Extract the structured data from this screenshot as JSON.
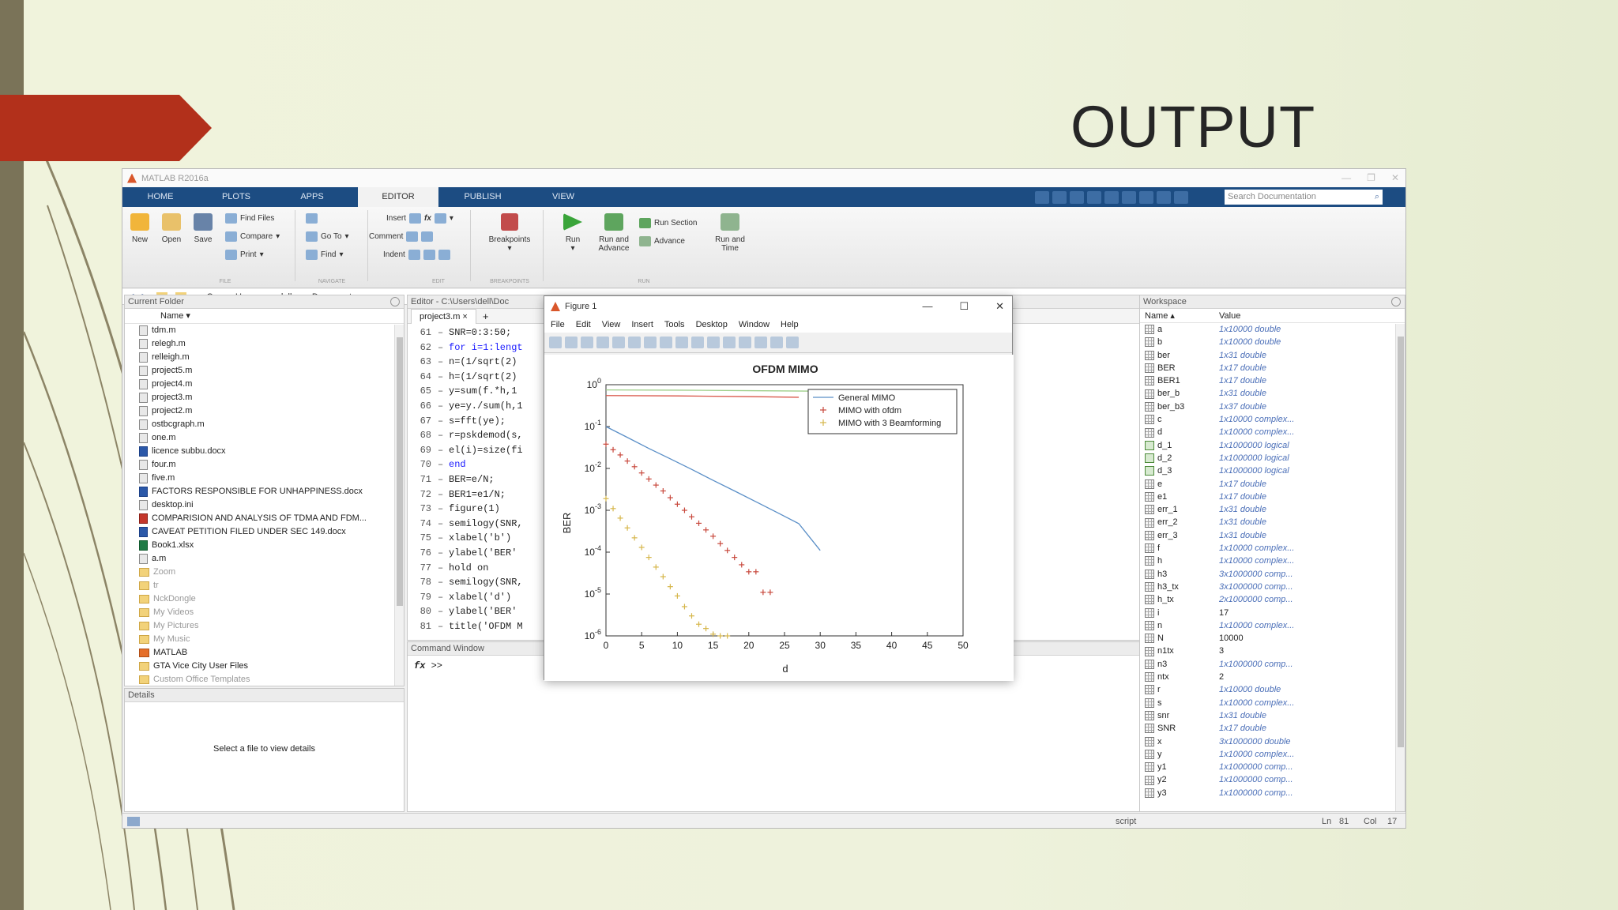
{
  "slide": {
    "title": "OUTPUT"
  },
  "app": {
    "title": "MATLAB R2016a",
    "tabs": [
      "HOME",
      "PLOTS",
      "APPS",
      "EDITOR",
      "PUBLISH",
      "VIEW"
    ],
    "active_tab": "EDITOR",
    "search_placeholder": "Search Documentation",
    "ribbon": {
      "file": {
        "new": "New",
        "open": "Open",
        "save": "Save",
        "find_files": "Find Files",
        "compare": "Compare",
        "print": "Print",
        "group": "FILE"
      },
      "navigate": {
        "go_to": "Go To",
        "find": "Find",
        "group": "NAVIGATE"
      },
      "edit": {
        "insert": "Insert",
        "comment": "Comment",
        "indent": "Indent",
        "fx": "fx",
        "group": "EDIT"
      },
      "breakpoints": {
        "label": "Breakpoints",
        "group": "BREAKPOINTS"
      },
      "run": {
        "run": "Run",
        "run_advance": "Run and Advance",
        "run_section": "Run Section",
        "advance": "Advance",
        "run_time": "Run and Time",
        "group": "RUN"
      }
    },
    "address": [
      "C:",
      "Users",
      "dell",
      "Documents"
    ],
    "colors": {
      "ribbon_tab": "#1c4c82",
      "accent_red": "#b2301b"
    }
  },
  "current_folder": {
    "title": "Current Folder",
    "column": "Name",
    "files": [
      {
        "name": "tdm.m",
        "type": "m"
      },
      {
        "name": "relegh.m",
        "type": "m"
      },
      {
        "name": "relleigh.m",
        "type": "m"
      },
      {
        "name": "project5.m",
        "type": "m"
      },
      {
        "name": "project4.m",
        "type": "m"
      },
      {
        "name": "project3.m",
        "type": "m"
      },
      {
        "name": "project2.m",
        "type": "m"
      },
      {
        "name": "ostbcgraph.m",
        "type": "m"
      },
      {
        "name": "one.m",
        "type": "m"
      },
      {
        "name": "licence subbu.docx",
        "type": "word"
      },
      {
        "name": "four.m",
        "type": "m"
      },
      {
        "name": "five.m",
        "type": "m"
      },
      {
        "name": "FACTORS RESPONSIBLE FOR UNHAPPINESS.docx",
        "type": "word"
      },
      {
        "name": "desktop.ini",
        "type": "ini"
      },
      {
        "name": "COMPARISION AND ANALYSIS OF TDMA AND FDM...",
        "type": "pdf"
      },
      {
        "name": "CAVEAT PETITION FILED UNDER SEC 149.docx",
        "type": "word"
      },
      {
        "name": "Book1.xlsx",
        "type": "xl"
      },
      {
        "name": "a.m",
        "type": "m"
      },
      {
        "name": "Zoom",
        "type": "folder-grey"
      },
      {
        "name": "tr",
        "type": "folder-grey"
      },
      {
        "name": "NckDongle",
        "type": "folder-grey"
      },
      {
        "name": "My Videos",
        "type": "folder-grey"
      },
      {
        "name": "My Pictures",
        "type": "folder-grey"
      },
      {
        "name": "My Music",
        "type": "folder-grey"
      },
      {
        "name": "MATLAB",
        "type": "mat"
      },
      {
        "name": "GTA Vice City User Files",
        "type": "folder"
      },
      {
        "name": "Custom Office Templates",
        "type": "folder-grey"
      }
    ],
    "details_title": "Details",
    "details_text": "Select a file to view details"
  },
  "editor": {
    "title": "Editor - C:\\Users\\dell\\Doc",
    "tab": "project3.m",
    "lines": [
      {
        "n": "61",
        "code": "SNR=0:3:50;"
      },
      {
        "n": "62",
        "code": "for i=1:lengt",
        "kw": true
      },
      {
        "n": "63",
        "code": "n=(1/sqrt(2)"
      },
      {
        "n": "64",
        "code": "h=(1/sqrt(2)"
      },
      {
        "n": "65",
        "code": "y=sum(f.*h,1"
      },
      {
        "n": "66",
        "code": "ye=y./sum(h,1"
      },
      {
        "n": "67",
        "code": "s=fft(ye);"
      },
      {
        "n": "68",
        "code": "r=pskdemod(s,"
      },
      {
        "n": "69",
        "code": "el(i)=size(fi"
      },
      {
        "n": "70",
        "code": "end",
        "kw": true
      },
      {
        "n": "71",
        "code": "BER=e/N;"
      },
      {
        "n": "72",
        "code": "BER1=e1/N;"
      },
      {
        "n": "73",
        "code": "figure(1)"
      },
      {
        "n": "74",
        "code": "semilogy(SNR,"
      },
      {
        "n": "75",
        "code": "xlabel('b')"
      },
      {
        "n": "76",
        "code": "ylabel('BER'"
      },
      {
        "n": "77",
        "code": "hold on"
      },
      {
        "n": "78",
        "code": "semilogy(SNR,"
      },
      {
        "n": "79",
        "code": "xlabel('d')"
      },
      {
        "n": "80",
        "code": "ylabel('BER'"
      },
      {
        "n": "81",
        "code": "title('OFDM M"
      }
    ]
  },
  "command_window": {
    "title": "Command Window",
    "prompt": ">>",
    "fx": "fx"
  },
  "workspace": {
    "title": "Workspace",
    "columns": [
      "Name",
      "Value"
    ],
    "vars": [
      {
        "name": "a",
        "value": "1x10000 double"
      },
      {
        "name": "b",
        "value": "1x10000 double"
      },
      {
        "name": "ber",
        "value": "1x31 double"
      },
      {
        "name": "BER",
        "value": "1x17 double"
      },
      {
        "name": "BER1",
        "value": "1x17 double"
      },
      {
        "name": "ber_b",
        "value": "1x31 double"
      },
      {
        "name": "ber_b3",
        "value": "1x37 double"
      },
      {
        "name": "c",
        "value": "1x10000 complex..."
      },
      {
        "name": "d",
        "value": "1x10000 complex..."
      },
      {
        "name": "d_1",
        "value": "1x1000000 logical",
        "chk": true
      },
      {
        "name": "d_2",
        "value": "1x1000000 logical",
        "chk": true
      },
      {
        "name": "d_3",
        "value": "1x1000000 logical",
        "chk": true
      },
      {
        "name": "e",
        "value": "1x17 double"
      },
      {
        "name": "e1",
        "value": "1x17 double"
      },
      {
        "name": "err_1",
        "value": "1x31 double"
      },
      {
        "name": "err_2",
        "value": "1x31 double"
      },
      {
        "name": "err_3",
        "value": "1x31 double"
      },
      {
        "name": "f",
        "value": "1x10000 complex..."
      },
      {
        "name": "h",
        "value": "1x10000 complex..."
      },
      {
        "name": "h3",
        "value": "3x1000000 comp..."
      },
      {
        "name": "h3_tx",
        "value": "3x1000000 comp..."
      },
      {
        "name": "h_tx",
        "value": "2x1000000 comp..."
      },
      {
        "name": "i",
        "value": "17",
        "plain": true
      },
      {
        "name": "n",
        "value": "1x10000 complex..."
      },
      {
        "name": "N",
        "value": "10000",
        "plain": true
      },
      {
        "name": "n1tx",
        "value": "3",
        "plain": true
      },
      {
        "name": "n3",
        "value": "1x1000000 comp..."
      },
      {
        "name": "ntx",
        "value": "2",
        "plain": true
      },
      {
        "name": "r",
        "value": "1x10000 double"
      },
      {
        "name": "s",
        "value": "1x10000 complex..."
      },
      {
        "name": "snr",
        "value": "1x31 double"
      },
      {
        "name": "SNR",
        "value": "1x17 double"
      },
      {
        "name": "x",
        "value": "3x1000000 double"
      },
      {
        "name": "y",
        "value": "1x10000 complex..."
      },
      {
        "name": "y1",
        "value": "1x1000000 comp..."
      },
      {
        "name": "y2",
        "value": "1x1000000 comp..."
      },
      {
        "name": "y3",
        "value": "1x1000000 comp..."
      }
    ]
  },
  "status": {
    "mode": "script",
    "ln_label": "Ln",
    "ln": "81",
    "col_label": "Col",
    "col": "17"
  },
  "figure": {
    "title": "Figure 1",
    "menu": [
      "File",
      "Edit",
      "View",
      "Insert",
      "Tools",
      "Desktop",
      "Window",
      "Help"
    ]
  },
  "chart_data": {
    "type": "line",
    "title": "OFDM MIMO",
    "xlabel": "d",
    "ylabel": "BER",
    "xlim": [
      0,
      50
    ],
    "ylim": [
      1e-06,
      1
    ],
    "yscale": "log",
    "xticks": [
      0,
      5,
      10,
      15,
      20,
      25,
      30,
      35,
      40,
      45,
      50
    ],
    "yticks": [
      1,
      0.1,
      0.01,
      0.001,
      0.0001,
      1e-05,
      1e-06
    ],
    "ytick_labels": [
      "10^0",
      "10^-1",
      "10^-2",
      "10^-3",
      "10^-4",
      "10^-5",
      "10^-6"
    ],
    "legend_position": "top-right",
    "series": [
      {
        "name": "General MIMO",
        "style": "line",
        "color": "#5b8fc7",
        "x": [
          0,
          3,
          6,
          9,
          12,
          15,
          18,
          21,
          24,
          27,
          30
        ],
        "y": [
          0.1,
          0.055,
          0.03,
          0.017,
          0.0095,
          0.0052,
          0.0029,
          0.0016,
          0.00088,
          0.00048,
          0.00011
        ]
      },
      {
        "name": "MIMO with ofdm",
        "style": "plus",
        "color": "#c8483c",
        "x": [
          0,
          1,
          2,
          3,
          4,
          5,
          6,
          7,
          8,
          9,
          10,
          11,
          12,
          13,
          14,
          15,
          16,
          17,
          18,
          19,
          20,
          21,
          22,
          23
        ],
        "y": [
          0.038,
          0.028,
          0.021,
          0.015,
          0.011,
          0.0078,
          0.0056,
          0.004,
          0.0029,
          0.002,
          0.0014,
          0.001,
          0.0007,
          0.00049,
          0.00034,
          0.00024,
          0.00016,
          0.00011,
          7.5e-05,
          5e-05,
          3.4e-05,
          3.4e-05,
          1.1e-05,
          1.1e-05
        ]
      },
      {
        "name": "MIMO with 3 Beamforming",
        "style": "plus",
        "color": "#d6b64a",
        "x": [
          0,
          1,
          2,
          3,
          4,
          5,
          6,
          7,
          8,
          9,
          10,
          11,
          12,
          13,
          14,
          15,
          16,
          17
        ],
        "y": [
          0.0019,
          0.0011,
          0.00065,
          0.00038,
          0.00022,
          0.00013,
          7.5e-05,
          4.4e-05,
          2.6e-05,
          1.5e-05,
          9e-06,
          5e-06,
          3e-06,
          1.9e-06,
          1.5e-06,
          1.1e-06,
          1e-06,
          1e-06
        ]
      },
      {
        "name": "",
        "style": "line",
        "color": "#d9574a",
        "x": [
          0,
          10,
          20,
          27
        ],
        "y": [
          0.55,
          0.54,
          0.52,
          0.5
        ]
      },
      {
        "name": "",
        "style": "line",
        "color": "#9fcf8a",
        "x": [
          0,
          10,
          20,
          30,
          37
        ],
        "y": [
          0.75,
          0.74,
          0.72,
          0.7,
          0.68
        ]
      }
    ]
  }
}
